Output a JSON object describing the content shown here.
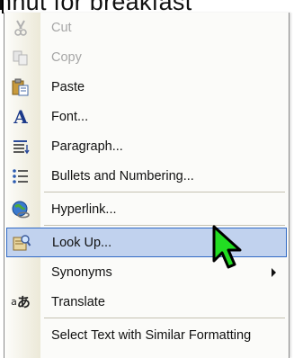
{
  "document": {
    "visible_text": "nnut for breakfast"
  },
  "context_menu": {
    "items": [
      {
        "label": "Cut",
        "icon": "scissors-icon",
        "enabled": false
      },
      {
        "label": "Copy",
        "icon": "copy-icon",
        "enabled": false
      },
      {
        "label": "Paste",
        "icon": "paste-icon",
        "enabled": true
      },
      {
        "label": "Font...",
        "icon": "font-icon",
        "enabled": true
      },
      {
        "label": "Paragraph...",
        "icon": "paragraph-icon",
        "enabled": true
      },
      {
        "label": "Bullets and Numbering...",
        "icon": "bullets-icon",
        "enabled": true
      },
      {
        "label": "Hyperlink...",
        "icon": "hyperlink-icon",
        "enabled": true
      },
      {
        "label": "Look Up...",
        "icon": "lookup-icon",
        "enabled": true,
        "highlighted": true
      },
      {
        "label": "Synonyms",
        "icon": "",
        "enabled": true,
        "submenu": true
      },
      {
        "label": "Translate",
        "icon": "translate-icon",
        "enabled": true
      },
      {
        "label": "Select Text with Similar Formatting",
        "icon": "",
        "enabled": true
      }
    ]
  },
  "colors": {
    "highlight_fill": "#c1d2ee",
    "highlight_border": "#316ac5",
    "menu_background": "#fbfbf9",
    "disabled_text": "#a6a6a6",
    "cursor_green": "#22dd22"
  }
}
